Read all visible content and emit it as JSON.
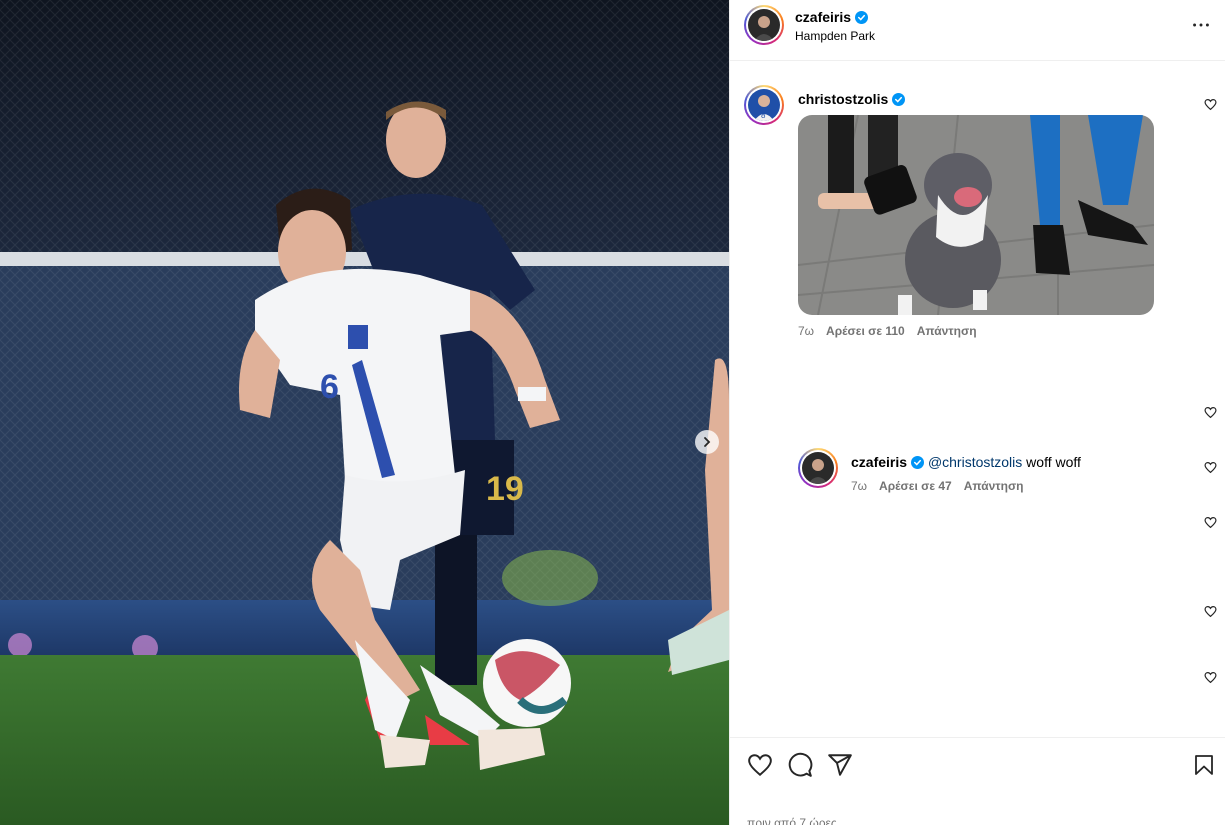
{
  "post": {
    "author": "czafeiris",
    "location": "Hampden Park",
    "timestamp": "πριν από 7 ώρες"
  },
  "comments": [
    {
      "username": "christostzolis",
      "age": "7ω",
      "likes": "Αρέσει σε 110",
      "reply_label": "Απάντηση"
    }
  ],
  "replies": [
    {
      "username": "czafeiris",
      "mention": "@christostzolis",
      "text": " woff woff",
      "age": "7ω",
      "likes": "Αρέσει σε 47",
      "reply_label": "Απάντηση"
    }
  ],
  "photo": {
    "player_front_number": "6",
    "player_back_number": "19"
  },
  "colors": {
    "verified": "#0095f6",
    "mention": "#00376b",
    "secondary_text": "#737373",
    "border": "#efefef"
  },
  "icons": {
    "more": "more-horizontal-icon",
    "like": "heart-icon",
    "comment": "comment-icon",
    "share": "send-icon",
    "save": "bookmark-icon",
    "next": "chevron-right-icon"
  }
}
